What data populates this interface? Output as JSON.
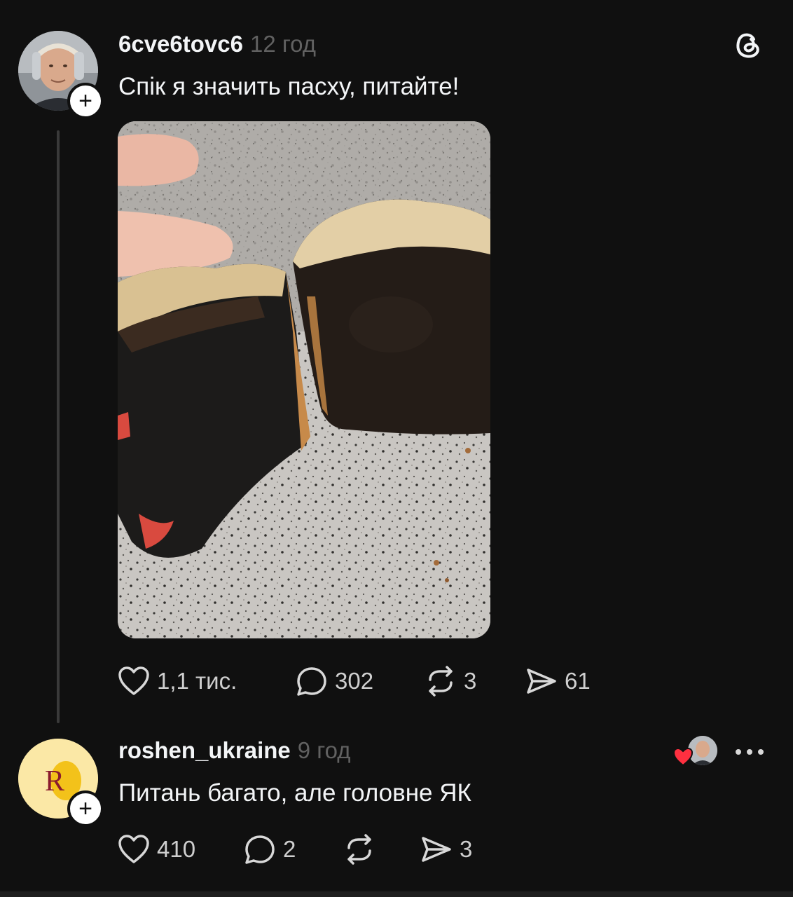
{
  "post": {
    "username": "6cve6tovc6",
    "time": "12 год",
    "text": "Спік я значить пасху, питайте!",
    "image_alt": "burnt-easter-bread-photo",
    "actions": {
      "likes": "1,1 тис.",
      "comments": "302",
      "reposts": "3",
      "shares": "61"
    }
  },
  "reply": {
    "username": "roshen_ukraine",
    "time": "9 год",
    "text": "Питань багато, але головне ЯК",
    "avatar_letter": "R",
    "actions": {
      "likes": "410",
      "comments": "2",
      "reposts": "",
      "shares": "3"
    }
  },
  "icons": {
    "app_logo": "threads-icon",
    "like": "heart-icon",
    "comment": "comment-bubble-icon",
    "repost": "repost-icon",
    "share": "send-icon",
    "more": "more-dots-icon",
    "follow": "plus-icon"
  },
  "colors": {
    "background": "#101010",
    "text": "#f3f5f7",
    "muted": "#616161",
    "like_red": "#ff3040",
    "roshen_yellow": "#fbe8a6"
  }
}
